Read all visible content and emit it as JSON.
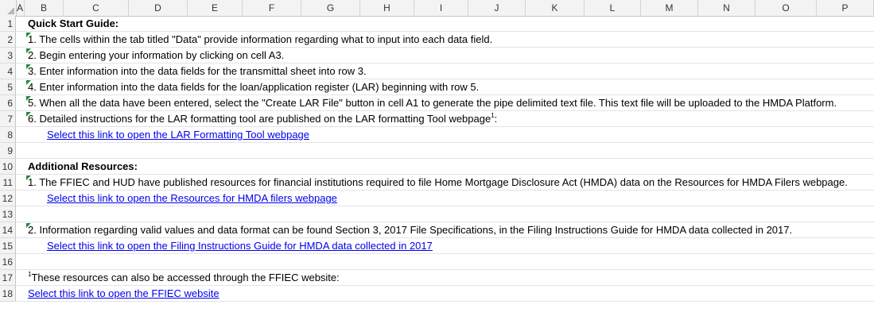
{
  "columns": [
    "A",
    "B",
    "C",
    "D",
    "E",
    "F",
    "G",
    "H",
    "I",
    "J",
    "K",
    "L",
    "M",
    "N",
    "O",
    "P"
  ],
  "rows": [
    {
      "num": "1",
      "text": "Quick Start Guide:",
      "kind": "bold",
      "col": "A",
      "tri": false
    },
    {
      "num": "2",
      "text": "1. The cells within the tab titled \"Data\" provide information regarding what to input into each data field.",
      "kind": "text",
      "col": "A",
      "tri": true
    },
    {
      "num": "3",
      "text": "2. Begin entering your information by clicking on cell A3.",
      "kind": "text",
      "col": "A",
      "tri": true
    },
    {
      "num": "4",
      "text": "3. Enter information into the data fields for the transmittal sheet into row 3.",
      "kind": "text",
      "col": "A",
      "tri": true
    },
    {
      "num": "5",
      "text": "4. Enter information into the data fields for the loan/application register (LAR) beginning with row 5.",
      "kind": "text",
      "col": "A",
      "tri": true
    },
    {
      "num": "6",
      "text": "5. When all the data have been entered, select the \"Create LAR File\" button in cell A1 to generate the pipe delimited text file. This text file will be uploaded to the HMDA Platform.",
      "kind": "text",
      "col": "A",
      "tri": true
    },
    {
      "num": "7",
      "text": "6. Detailed instructions for the LAR formatting tool are published on the LAR formatting Tool webpage",
      "sup": "1",
      "suffix": ":",
      "kind": "text",
      "col": "A",
      "tri": true
    },
    {
      "num": "8",
      "text": "Select this link to open the LAR Formatting Tool webpage",
      "kind": "link",
      "col": "B",
      "tri": false
    },
    {
      "num": "9",
      "text": "",
      "kind": "text",
      "col": "A",
      "tri": false
    },
    {
      "num": "10",
      "text": "Additional Resources:",
      "kind": "bold",
      "col": "A",
      "tri": false
    },
    {
      "num": "11",
      "text": "1. The FFIEC and HUD have published resources for financial institutions required to file Home Mortgage Disclosure Act (HMDA) data on the Resources for HMDA Filers webpage.",
      "kind": "text",
      "col": "A",
      "tri": true
    },
    {
      "num": "12",
      "text": "Select this link to open the Resources for HMDA filers webpage",
      "kind": "link",
      "col": "B",
      "tri": false
    },
    {
      "num": "13",
      "text": "",
      "kind": "text",
      "col": "A",
      "tri": false
    },
    {
      "num": "14",
      "text": "2. Information regarding valid values and data format can be found Section 3, 2017 File Specifications, in the Filing Instructions Guide for HMDA data collected in 2017.",
      "kind": "text",
      "col": "A",
      "tri": true
    },
    {
      "num": "15",
      "text": "Select this link to open the Filing Instructions Guide for HMDA data collected in 2017",
      "kind": "link",
      "col": "B",
      "tri": false
    },
    {
      "num": "16",
      "text": "",
      "kind": "text",
      "col": "A",
      "tri": false
    },
    {
      "num": "17",
      "pre_sup": "1",
      "text": "These resources can also be accessed through the FFIEC website:",
      "kind": "text",
      "col": "A",
      "tri": false
    },
    {
      "num": "18",
      "text": "Select this link to open the FFIEC website",
      "kind": "link",
      "col": "A",
      "tri": false
    }
  ],
  "colors": {
    "link": "#0000ee",
    "note_marker": "#1e8e3e",
    "header_bg": "#f3f3f3"
  }
}
